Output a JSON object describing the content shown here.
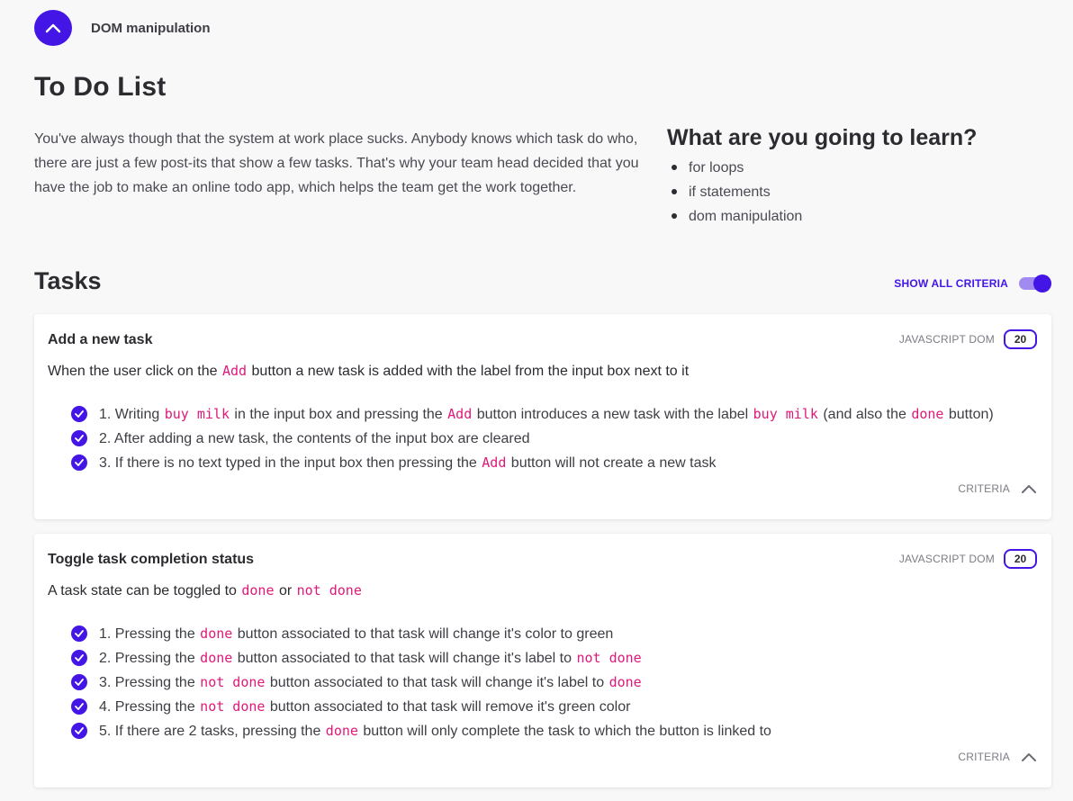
{
  "topbar": {
    "title": "DOM manipulation",
    "back_icon": "chevron-up-icon"
  },
  "page": {
    "title": "To Do List",
    "intro": "You've always though that the system at work place sucks. Anybody knows which task do who, there are just a few post-its that show a few tasks. That's why your team head decided that you have the job to make an online todo app, which helps the team get the work together."
  },
  "learn": {
    "title": "What are you going to learn?",
    "items": [
      "for loops",
      "if statements",
      "dom manipulation"
    ]
  },
  "tasks": {
    "title": "Tasks",
    "show_all_label": "SHOW ALL CRITERIA",
    "show_all_enabled": true
  },
  "cards": [
    {
      "title": "Add a new task",
      "tag": "JAVASCRIPT DOM",
      "points": "20",
      "description": [
        {
          "t": "When the user click on the "
        },
        {
          "c": "Add"
        },
        {
          "t": " button a new task is added with the label from the input box next to it"
        }
      ],
      "criteria": [
        [
          {
            "t": "1. Writing "
          },
          {
            "c": "buy milk"
          },
          {
            "t": " in the input box and pressing the "
          },
          {
            "c": "Add"
          },
          {
            "t": " button introduces a new task with the label "
          },
          {
            "c": "buy milk"
          },
          {
            "t": " (and also the "
          },
          {
            "c": "done"
          },
          {
            "t": " button)"
          }
        ],
        [
          {
            "t": "2. After adding a new task, the contents of the input box are cleared"
          }
        ],
        [
          {
            "t": "3. If there is no text typed in the input box then pressing the "
          },
          {
            "c": "Add"
          },
          {
            "t": " button will not create a new task"
          }
        ]
      ],
      "footer_label": "CRITERIA"
    },
    {
      "title": "Toggle task completion status",
      "tag": "JAVASCRIPT DOM",
      "points": "20",
      "description": [
        {
          "t": "A task state can be toggled to "
        },
        {
          "c": "done"
        },
        {
          "t": " or "
        },
        {
          "c": "not done"
        }
      ],
      "criteria": [
        [
          {
            "t": "1. Pressing the "
          },
          {
            "c": "done"
          },
          {
            "t": " button associated to that task will change it's color to green"
          }
        ],
        [
          {
            "t": "2. Pressing the "
          },
          {
            "c": "done"
          },
          {
            "t": " button associated to that task will change it's label to "
          },
          {
            "c": "not done"
          }
        ],
        [
          {
            "t": "3. Pressing the "
          },
          {
            "c": "not done"
          },
          {
            "t": " button associated to that task will change it's label to "
          },
          {
            "c": "done"
          }
        ],
        [
          {
            "t": "4. Pressing the "
          },
          {
            "c": "not done"
          },
          {
            "t": " button associated to that task will remove it's green color"
          }
        ],
        [
          {
            "t": "5. If there are 2 tasks, pressing the "
          },
          {
            "c": "done"
          },
          {
            "t": " button will only complete the task to which the button is linked to"
          }
        ]
      ],
      "footer_label": "CRITERIA"
    }
  ],
  "colors": {
    "accent": "#4316e6",
    "code": "#e0187a",
    "background": "#f8f8f9"
  }
}
